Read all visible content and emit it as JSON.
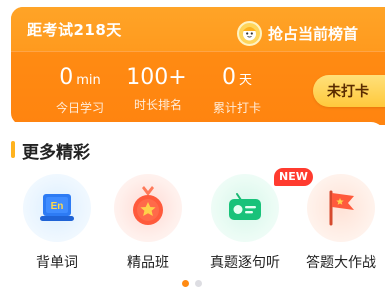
{
  "study_card": {
    "countdown": "距考试218天",
    "rank_label": "抢占当前榜首",
    "stats": [
      {
        "value": "0",
        "unit": "min",
        "label": "今日学习"
      },
      {
        "value": "100+",
        "unit": "",
        "label": "时长排名"
      },
      {
        "value": "0",
        "unit": "天",
        "label": "累计打卡"
      }
    ],
    "checkin_label": "未打卡",
    "colors": {
      "accent": "#ff8a12",
      "checkin_bg": "#ffc93c"
    }
  },
  "more_section": {
    "title": "更多精彩",
    "features": [
      {
        "label": "背单词",
        "icon": "en-book-icon"
      },
      {
        "label": "精品班",
        "icon": "medal-star-icon"
      },
      {
        "label": "真题逐句听",
        "icon": "radio-icon",
        "badge": "NEW"
      },
      {
        "label": "答题大作战",
        "icon": "flag-icon"
      }
    ]
  },
  "pager": {
    "current": 1,
    "total": 2
  }
}
